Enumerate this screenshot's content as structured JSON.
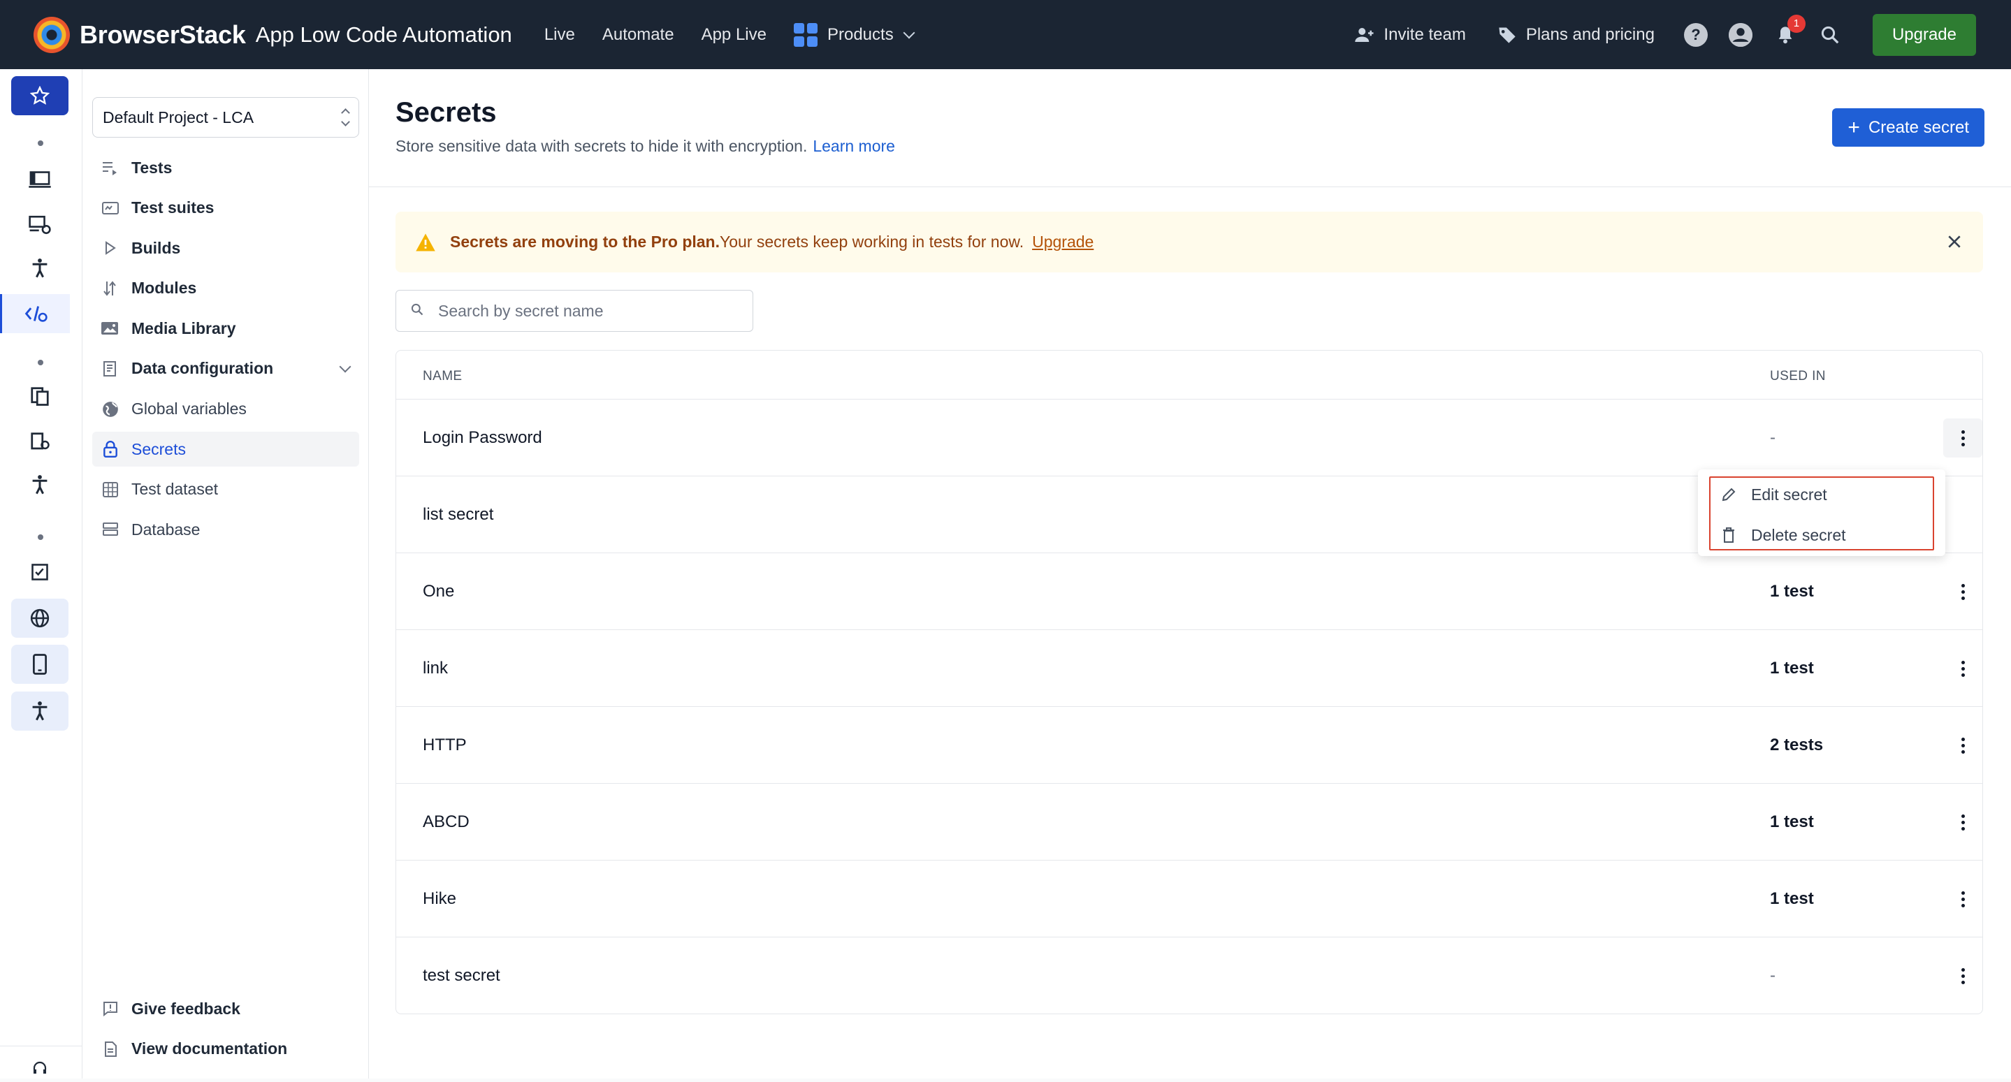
{
  "topbar": {
    "brand_name": "BrowserStack",
    "product_name": "App Low Code Automation",
    "nav": [
      "Live",
      "Automate",
      "App Live"
    ],
    "products_label": "Products",
    "invite_label": "Invite team",
    "plans_label": "Plans and pricing",
    "notification_count": "1",
    "upgrade_label": "Upgrade"
  },
  "sidebar": {
    "project_selector": "Default Project - LCA",
    "items": [
      {
        "label": "Tests",
        "icon": "tests-icon"
      },
      {
        "label": "Test suites",
        "icon": "test-suites-icon"
      },
      {
        "label": "Builds",
        "icon": "play-icon"
      },
      {
        "label": "Modules",
        "icon": "modules-icon"
      },
      {
        "label": "Media Library",
        "icon": "image-icon"
      },
      {
        "label": "Data configuration",
        "icon": "data-config-icon"
      },
      {
        "label": "Global variables",
        "icon": "globe-icon"
      },
      {
        "label": "Secrets",
        "icon": "lock-icon"
      },
      {
        "label": "Test dataset",
        "icon": "dataset-icon"
      },
      {
        "label": "Database",
        "icon": "database-icon"
      }
    ],
    "feedback_label": "Give feedback",
    "docs_label": "View documentation"
  },
  "page": {
    "title": "Secrets",
    "subtitle": "Store sensitive data with secrets to hide it with encryption.",
    "learn_more": "Learn more",
    "create_button": "Create secret"
  },
  "banner": {
    "bold_text": "Secrets are moving to the Pro plan.",
    "text": "Your secrets keep working in tests for now.",
    "link": "Upgrade"
  },
  "search": {
    "placeholder": "Search by secret name"
  },
  "table": {
    "headers": {
      "name": "NAME",
      "used_in": "USED IN"
    },
    "rows": [
      {
        "name": "Login Password",
        "used_in": "-"
      },
      {
        "name": "list secret",
        "used_in": ""
      },
      {
        "name": "One",
        "used_in": "1 test"
      },
      {
        "name": "link",
        "used_in": "1 test"
      },
      {
        "name": "HTTP",
        "used_in": "2 tests"
      },
      {
        "name": "ABCD",
        "used_in": "1 test"
      },
      {
        "name": "Hike",
        "used_in": "1 test"
      },
      {
        "name": "test secret",
        "used_in": "-"
      }
    ]
  },
  "context_menu": {
    "edit": "Edit secret",
    "delete": "Delete secret"
  },
  "colors": {
    "topbar": "#1b2533",
    "primary": "#1f5fd6",
    "upgrade": "#2e7d32",
    "banner_bg": "#fffbeb",
    "highlight": "#d9432f"
  }
}
